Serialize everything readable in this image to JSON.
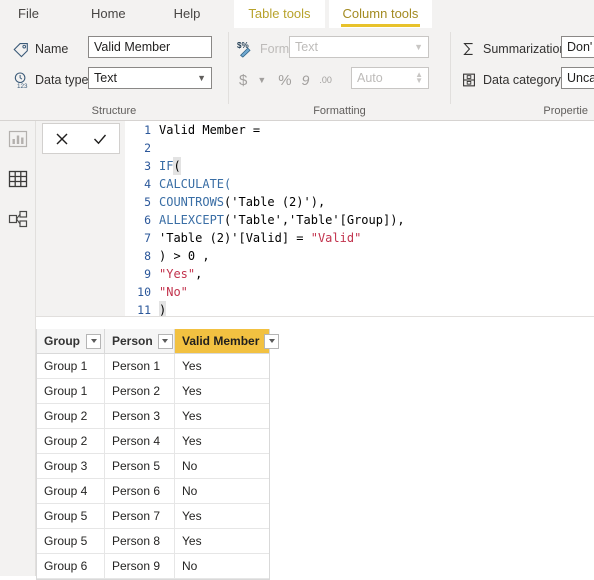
{
  "ribbon_tabs": [
    {
      "label": "File",
      "type": "file"
    },
    {
      "label": "Home",
      "type": "normal"
    },
    {
      "label": "Help",
      "type": "normal"
    },
    {
      "label": "Table tools",
      "type": "context"
    },
    {
      "label": "Column tools",
      "type": "context-active"
    }
  ],
  "ribbon": {
    "structure": {
      "group_label": "Structure",
      "name_label": "Name",
      "name_value": "Valid Member",
      "datatype_label": "Data type",
      "datatype_value": "Text"
    },
    "formatting": {
      "group_label": "Formatting",
      "format_label": "Format",
      "format_value": "Text",
      "currency_glyph": "$",
      "percent_glyph": "%",
      "thousands_glyph": "9",
      "decimals_glyph": ".00",
      "decimal_places_value": "Auto"
    },
    "properties": {
      "group_label": "Propertie",
      "summarization_label": "Summarization",
      "summarization_value": "Don'",
      "datacategory_label": "Data category",
      "datacategory_value": "Unca"
    }
  },
  "nav_rail": {
    "items": [
      {
        "name": "report-view-icon",
        "title": "Report"
      },
      {
        "name": "data-view-icon",
        "title": "Data"
      },
      {
        "name": "model-view-icon",
        "title": "Model"
      }
    ]
  },
  "formula_bar": {
    "cancel_glyph": "✕",
    "commit_glyph": "✓",
    "lines": [
      {
        "no": "1",
        "segments": [
          {
            "t": "Valid Member =",
            "c": "code"
          }
        ]
      },
      {
        "no": "2",
        "segments": []
      },
      {
        "no": "3",
        "segments": [
          {
            "t": "IF",
            "c": "fn"
          },
          {
            "t": "(",
            "c": "cursor"
          }
        ]
      },
      {
        "no": "4",
        "segments": [
          {
            "t": "CALCULATE(",
            "c": "fn"
          }
        ]
      },
      {
        "no": "5",
        "segments": [
          {
            "t": "COUNTROWS",
            "c": "fn"
          },
          {
            "t": "('Table (2)'),",
            "c": "code"
          }
        ]
      },
      {
        "no": "6",
        "segments": [
          {
            "t": "ALLEXCEPT",
            "c": "fn"
          },
          {
            "t": "('Table','Table'[Group]),",
            "c": "code"
          }
        ]
      },
      {
        "no": "7",
        "segments": [
          {
            "t": "'Table (2)'[Valid] = ",
            "c": "code"
          },
          {
            "t": "\"Valid\"",
            "c": "str"
          }
        ]
      },
      {
        "no": "8",
        "segments": [
          {
            "t": ") > 0 ,",
            "c": "code"
          }
        ]
      },
      {
        "no": "9",
        "segments": [
          {
            "t": "\"Yes\"",
            "c": "str"
          },
          {
            "t": ",",
            "c": "code"
          }
        ]
      },
      {
        "no": "10",
        "segments": [
          {
            "t": "\"No\"",
            "c": "str"
          }
        ]
      },
      {
        "no": "11",
        "segments": [
          {
            "t": ")",
            "c": "cursor"
          }
        ]
      }
    ]
  },
  "data_grid": {
    "columns": [
      {
        "label": "Group",
        "selected": false
      },
      {
        "label": "Person",
        "selected": false
      },
      {
        "label": "Valid Member",
        "selected": true
      }
    ],
    "rows": [
      [
        "Group 1",
        "Person 1",
        "Yes"
      ],
      [
        "Group 1",
        "Person 2",
        "Yes"
      ],
      [
        "Group 2",
        "Person 3",
        "Yes"
      ],
      [
        "Group 2",
        "Person 4",
        "Yes"
      ],
      [
        "Group 3",
        "Person 5",
        "No"
      ],
      [
        "Group 4",
        "Person 6",
        "No"
      ],
      [
        "Group 5",
        "Person 7",
        "Yes"
      ],
      [
        "Group 5",
        "Person 8",
        "Yes"
      ],
      [
        "Group 6",
        "Person 9",
        "No"
      ]
    ]
  },
  "colors": {
    "accent_yellow": "#f2c141",
    "context_tab_text": "#b8a32c",
    "ribbon_bg": "#f3f2f1",
    "function_blue": "#3a6ea5",
    "string_red": "#c2334d",
    "line_number_blue": "#2b579a"
  }
}
